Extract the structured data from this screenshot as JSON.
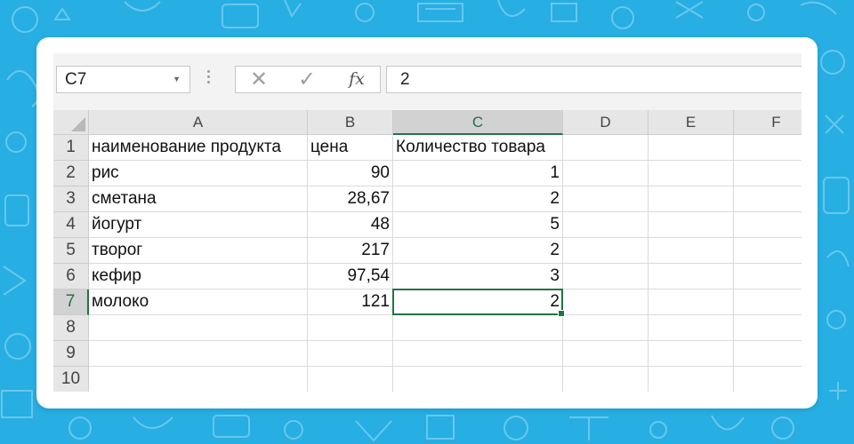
{
  "formula_bar": {
    "name_box": "C7",
    "fx_label": "fx",
    "formula_value": "2"
  },
  "columns": [
    "A",
    "B",
    "C",
    "D",
    "E",
    "F"
  ],
  "rows": [
    {
      "n": "1",
      "a": "наименование продукта",
      "b": "цена",
      "c": "Количество товара"
    },
    {
      "n": "2",
      "a": "рис",
      "b": "90",
      "c": "1"
    },
    {
      "n": "3",
      "a": "сметана",
      "b": "28,67",
      "c": "2"
    },
    {
      "n": "4",
      "a": "йогурт",
      "b": "48",
      "c": "5"
    },
    {
      "n": "5",
      "a": "творог",
      "b": "217",
      "c": "2"
    },
    {
      "n": "6",
      "a": "кефир",
      "b": "97,54",
      "c": "3"
    },
    {
      "n": "7",
      "a": "молоко",
      "b": "121",
      "c": "2"
    },
    {
      "n": "8",
      "a": "",
      "b": "",
      "c": ""
    },
    {
      "n": "9",
      "a": "",
      "b": "",
      "c": ""
    },
    {
      "n": "10",
      "a": "",
      "b": "",
      "c": ""
    }
  ],
  "colors": {
    "background": "#27aee3",
    "excel_green": "#217346"
  }
}
